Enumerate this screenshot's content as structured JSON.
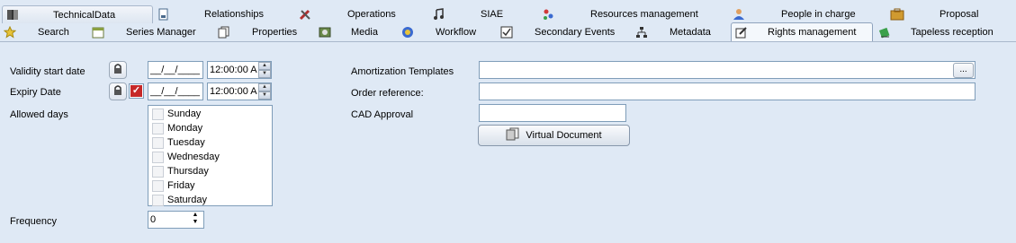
{
  "tabs_row1": [
    {
      "label": "TechnicalData",
      "icon": "book-icon"
    },
    {
      "label": "Relationships",
      "icon": "document-icon"
    },
    {
      "label": "Operations",
      "icon": "tools-icon"
    },
    {
      "label": "SIAE",
      "icon": "music-note-icon"
    },
    {
      "label": "Resources management",
      "icon": "resources-icon"
    },
    {
      "label": "People in charge",
      "icon": "person-icon"
    },
    {
      "label": "Proposal",
      "icon": "suitcase-icon"
    }
  ],
  "tabs_row2": [
    {
      "label": "Search",
      "icon": "star-search-icon"
    },
    {
      "label": "Series Manager",
      "icon": "calendar-icon"
    },
    {
      "label": "Properties",
      "icon": "pages-icon"
    },
    {
      "label": "Media",
      "icon": "media-icon"
    },
    {
      "label": "Workflow",
      "icon": "workflow-icon"
    },
    {
      "label": "Secondary Events",
      "icon": "checklist-icon"
    },
    {
      "label": "Metadata",
      "icon": "hierarchy-icon"
    },
    {
      "label": "Rights management",
      "icon": "edit-icon",
      "active": true
    },
    {
      "label": "Tapeless reception",
      "icon": "receive-icon"
    }
  ],
  "form": {
    "validity_label": "Validity start date",
    "validity_date": "__/__/____",
    "validity_time": "12:00:00 A",
    "expiry_label": "Expiry Date",
    "expiry_date": "__/__/____",
    "expiry_time": "12:00:00 A",
    "allowed_days_label": "Allowed days",
    "days": [
      "Sunday",
      "Monday",
      "Tuesday",
      "Wednesday",
      "Thursday",
      "Friday",
      "Saturday"
    ],
    "frequency_label": "Frequency",
    "frequency_value": "0",
    "amortization_label": "Amortization Templates",
    "amortization_button": "...",
    "order_label": "Order reference:",
    "cad_label": "CAD Approval",
    "virtual_doc_label": "Virtual Document"
  },
  "colors": {
    "background": "#dfe9f5",
    "expiry_check": "#c62828"
  }
}
